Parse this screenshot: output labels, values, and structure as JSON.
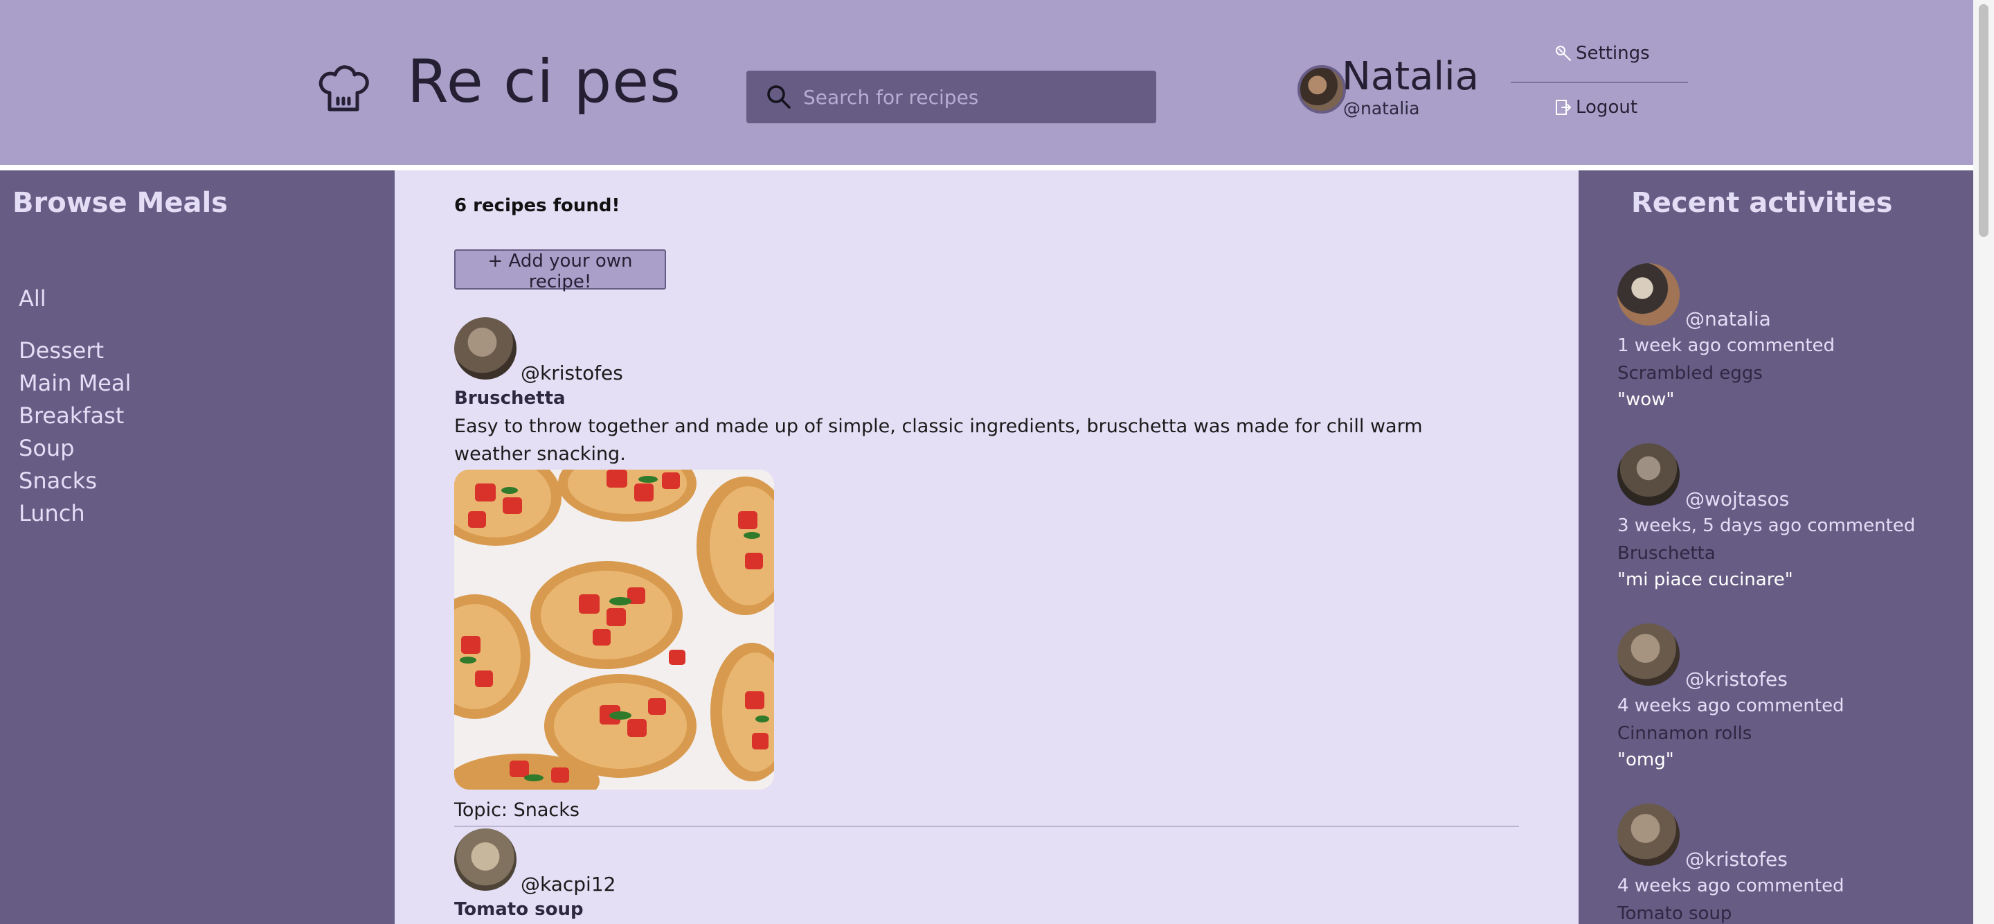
{
  "header": {
    "title": "Re ci pes",
    "search": {
      "placeholder": "Search for recipes",
      "value": ""
    },
    "user": {
      "name": "Natalia",
      "handle": "@natalia"
    },
    "menu": {
      "settings_label": "Settings",
      "logout_label": "Logout"
    }
  },
  "sidebar": {
    "title": "Browse Meals",
    "items": [
      "All",
      "Dessert",
      "Main Meal",
      "Breakfast",
      "Soup",
      "Snacks",
      "Lunch"
    ]
  },
  "main": {
    "found_text": "6 recipes found!",
    "add_button_label": "+ Add your own recipe!",
    "recipes": [
      {
        "author": "@kristofes",
        "title": "Bruschetta",
        "description": "Easy to throw together and made up of simple, classic ingredients, bruschetta was made for chill warm weather snacking.",
        "topic": "Topic: Snacks"
      },
      {
        "author": "@kacpi12",
        "title": "Tomato soup"
      }
    ]
  },
  "activities": {
    "title": "Recent activities",
    "items": [
      {
        "handle": "@natalia",
        "meta": "1 week ago commented",
        "recipe": "Scrambled eggs",
        "comment": "\"wow\""
      },
      {
        "handle": "@wojtasos",
        "meta": "3 weeks, 5 days ago commented",
        "recipe": "Bruschetta",
        "comment": "\"mi piace cucinare\""
      },
      {
        "handle": "@kristofes",
        "meta": "4 weeks ago commented",
        "recipe": "Cinnamon rolls",
        "comment": "\"omg\""
      },
      {
        "handle": "@kristofes",
        "meta": "4 weeks ago commented",
        "recipe": "Tomato soup"
      }
    ]
  },
  "colors": {
    "header_bg": "#a99fc9",
    "sidebar_bg": "#665c84",
    "main_bg": "#e4dff5",
    "text_light": "#e4ddf6"
  }
}
